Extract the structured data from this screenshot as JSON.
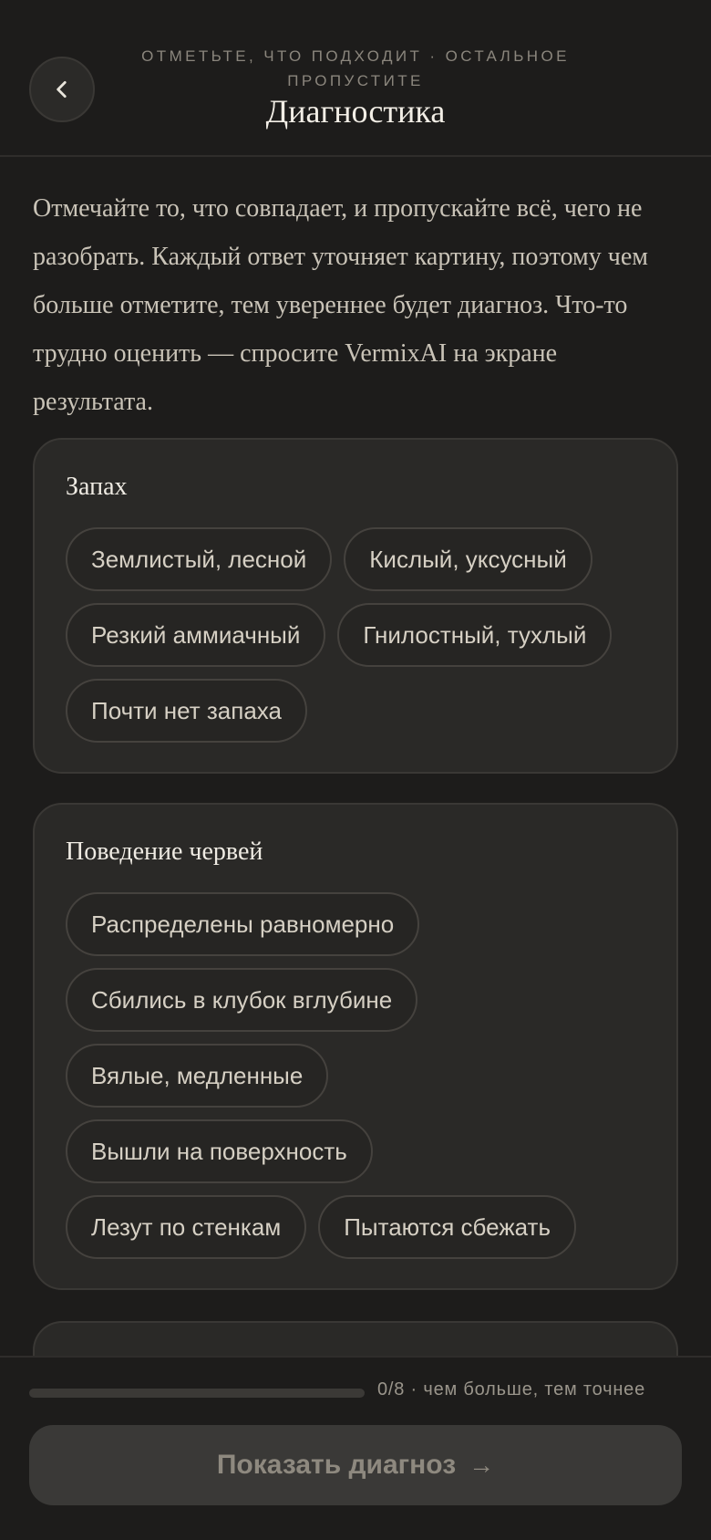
{
  "header": {
    "back_icon": "chevron-left-icon",
    "subtitle": "ОТМЕТЬТЕ, ЧТО ПОДХОДИТ · ОСТАЛЬНОЕ ПРОПУСТИТЕ",
    "title": "Диагностика"
  },
  "intro": "Отмечайте то, что совпадает, и пропускайте всё, чего не разобрать. Каждый ответ уточняет картину, поэтому чем больше отметите, тем увереннее будет диагноз. Что-то трудно оценить — спросите VermixAI на экране результата.",
  "sections": [
    {
      "title": "Запах",
      "options": [
        "Землистый, лесной",
        "Кислый, уксусный",
        "Резкий аммиачный",
        "Гнилостный, тухлый",
        "Почти нет запаха"
      ]
    },
    {
      "title": "Поведение червей",
      "options": [
        "Распределены равномерно",
        "Сбились в клубок вглубине",
        "Вялые, медленные",
        "Вышли на поверхность",
        "Лезут по стенкам",
        "Пытаются сбежать"
      ]
    }
  ],
  "footer": {
    "progress_value": 0,
    "progress_total": 8,
    "progress_text": "0/8 · чем больше, тем точнее",
    "cta_label": "Показать диагноз",
    "cta_icon": "arrow-right-icon"
  }
}
